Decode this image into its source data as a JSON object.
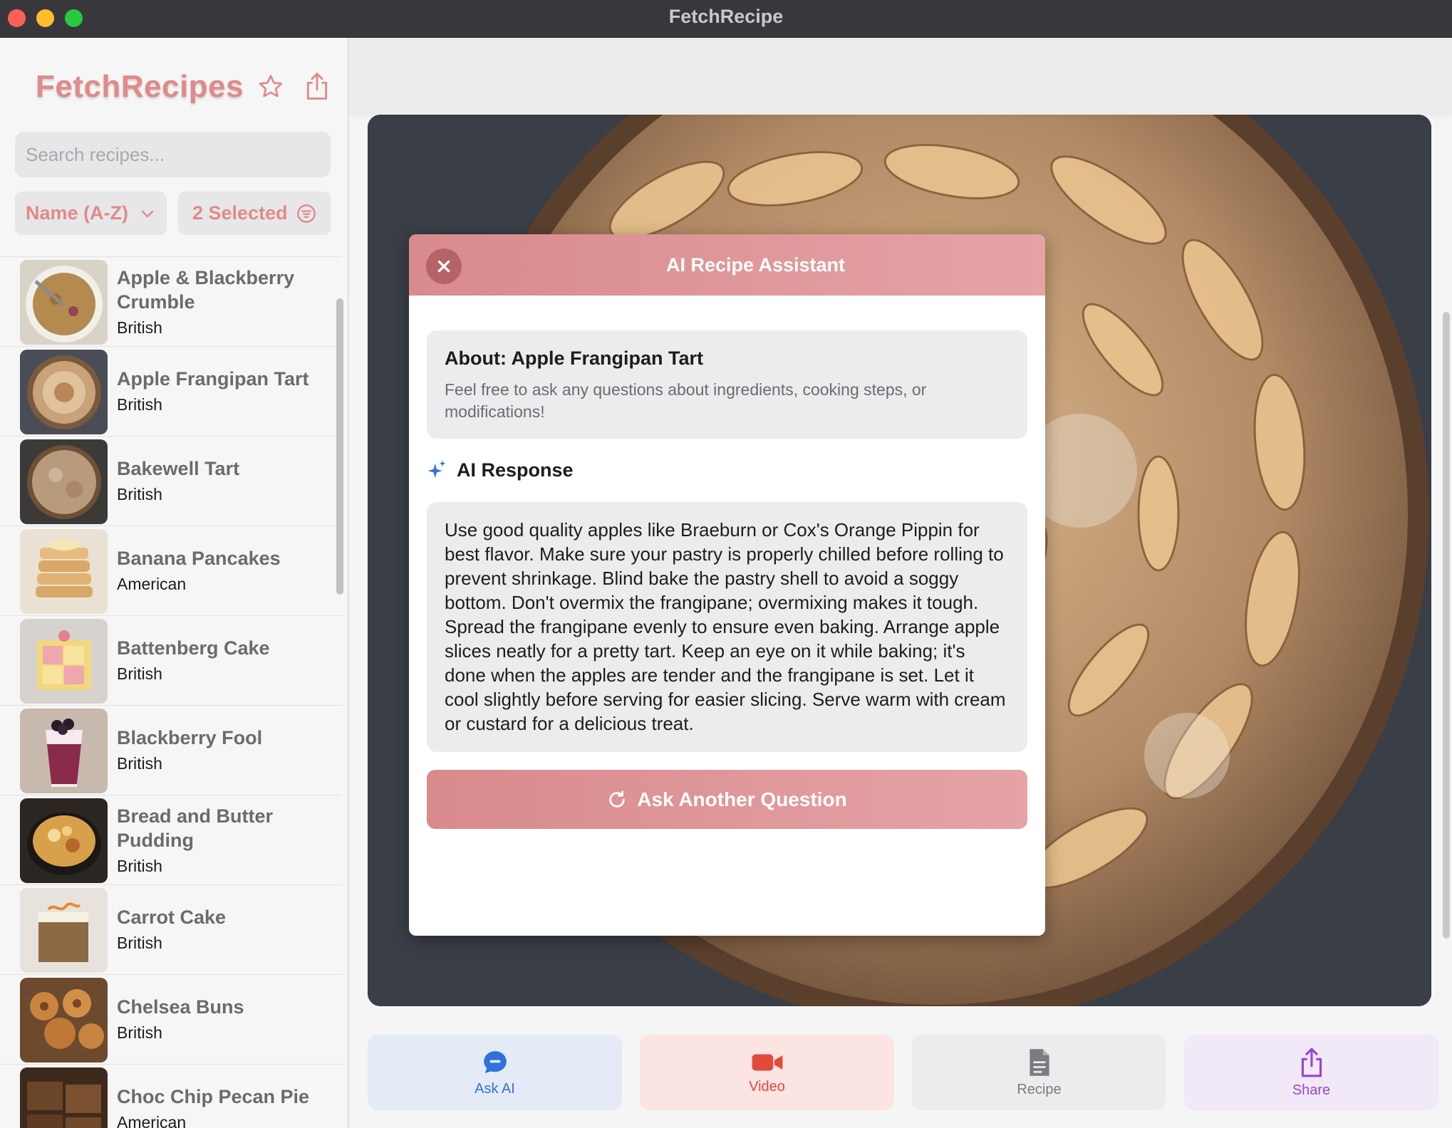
{
  "window": {
    "title": "FetchRecipe"
  },
  "sidebar": {
    "app_title": "FetchRecipes",
    "search": {
      "placeholder": "Search recipes...",
      "value": ""
    },
    "sort": {
      "label": "Name (A-Z)"
    },
    "filter": {
      "label": "2 Selected"
    },
    "recipes": [
      {
        "name": "Apple & Blackberry Crumble",
        "cuisine": "British"
      },
      {
        "name": "Apple Frangipan Tart",
        "cuisine": "British"
      },
      {
        "name": "Bakewell Tart",
        "cuisine": "British"
      },
      {
        "name": "Banana Pancakes",
        "cuisine": "American"
      },
      {
        "name": "Battenberg Cake",
        "cuisine": "British"
      },
      {
        "name": "Blackberry Fool",
        "cuisine": "British"
      },
      {
        "name": "Bread and Butter Pudding",
        "cuisine": "British"
      },
      {
        "name": "Carrot Cake",
        "cuisine": "British"
      },
      {
        "name": "Chelsea Buns",
        "cuisine": "British"
      },
      {
        "name": "Choc Chip Pecan Pie",
        "cuisine": "American"
      }
    ]
  },
  "modal": {
    "title": "AI Recipe Assistant",
    "about_title": "About: Apple Frangipan Tart",
    "about_subtitle": "Feel free to ask any questions about ingredients, cooking steps, or modifications!",
    "response_heading": "AI Response",
    "response_text": "Use good quality apples like Braeburn or Cox's Orange Pippin for best flavor.  Make sure your pastry is properly chilled before rolling to prevent shrinkage. Blind bake the pastry shell to avoid a soggy bottom. Don't overmix the frangipane; overmixing makes it tough.  Spread the frangipane evenly to ensure even baking. Arrange apple slices neatly for a pretty tart.  Keep an eye on it while baking; it's done when the apples are tender and the frangipane is set. Let it cool slightly before serving for easier slicing.  Serve warm with cream or custard for a delicious treat.",
    "ask_button": "Ask Another Question"
  },
  "actions": {
    "ask_ai": "Ask AI",
    "video": "Video",
    "recipe": "Recipe",
    "share": "Share"
  },
  "colors": {
    "brand": "#e08a8a",
    "ask_ai": "#2f73d9",
    "video": "#e24a3c",
    "share": "#9b45cf"
  }
}
